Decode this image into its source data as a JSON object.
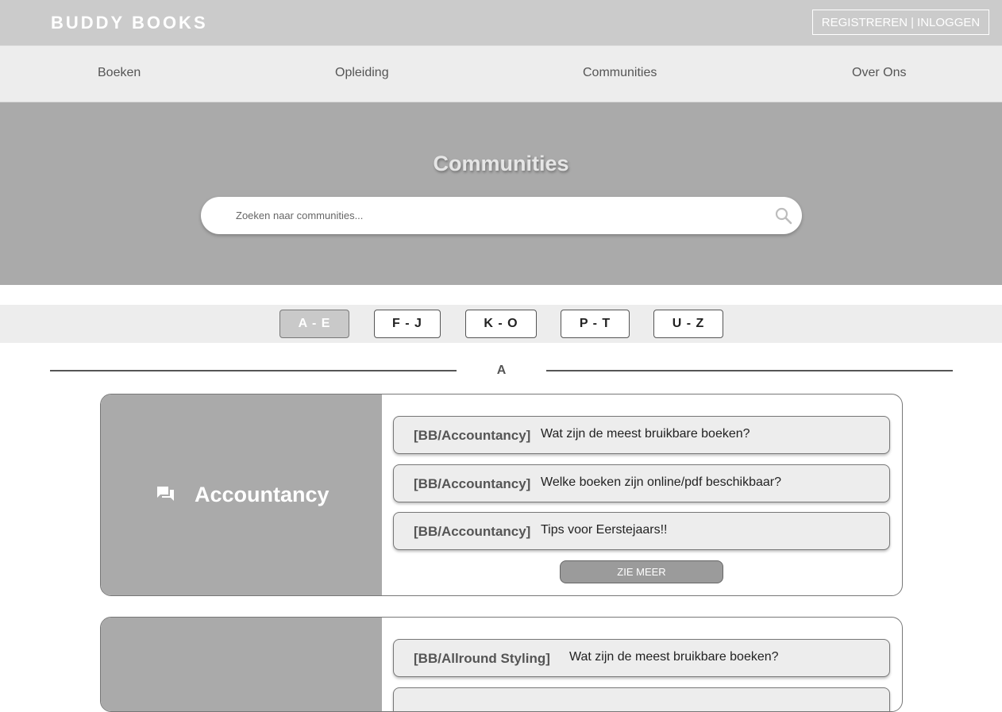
{
  "header": {
    "brand": "BUDDY BOOKS",
    "register_label": "REGISTREREN",
    "separator": "|",
    "login_label": "INLOGGEN"
  },
  "nav": {
    "items": [
      {
        "label": "Boeken"
      },
      {
        "label": "Opleiding"
      },
      {
        "label": "Communities"
      },
      {
        "label": "Over Ons"
      }
    ]
  },
  "hero": {
    "title": "Communities",
    "search_placeholder": "Zoeken naar communities..."
  },
  "filters": {
    "items": [
      {
        "label": "A - E",
        "active": true
      },
      {
        "label": "F - J",
        "active": false
      },
      {
        "label": "K - O",
        "active": false
      },
      {
        "label": "P - T",
        "active": false
      },
      {
        "label": "U - Z",
        "active": false
      }
    ]
  },
  "section": {
    "letter": "A"
  },
  "communities": [
    {
      "name": "Accountancy",
      "posts": [
        {
          "tag": "[BB/Accountancy]",
          "text": "Wat zijn de meest bruikbare boeken?"
        },
        {
          "tag": "[BB/Accountancy]",
          "text": "Welke boeken zijn online/pdf beschikbaar?"
        },
        {
          "tag": "[BB/Accountancy]",
          "text": "Tips voor Eerstejaars!!"
        }
      ],
      "more_label": "ZIE MEER"
    },
    {
      "name": "",
      "posts": [
        {
          "tag": "[BB/Allround Styling]",
          "text": "Wat zijn de meest bruikbare boeken?"
        }
      ]
    }
  ],
  "colors": {
    "topbar": "#cbcbcb",
    "navbar": "#ededed",
    "hero": "#aaaaaa",
    "card_accent": "#aaaaaa",
    "post_bg": "#ededed"
  },
  "icons": {
    "search": "search-icon",
    "community": "chat-icon"
  }
}
